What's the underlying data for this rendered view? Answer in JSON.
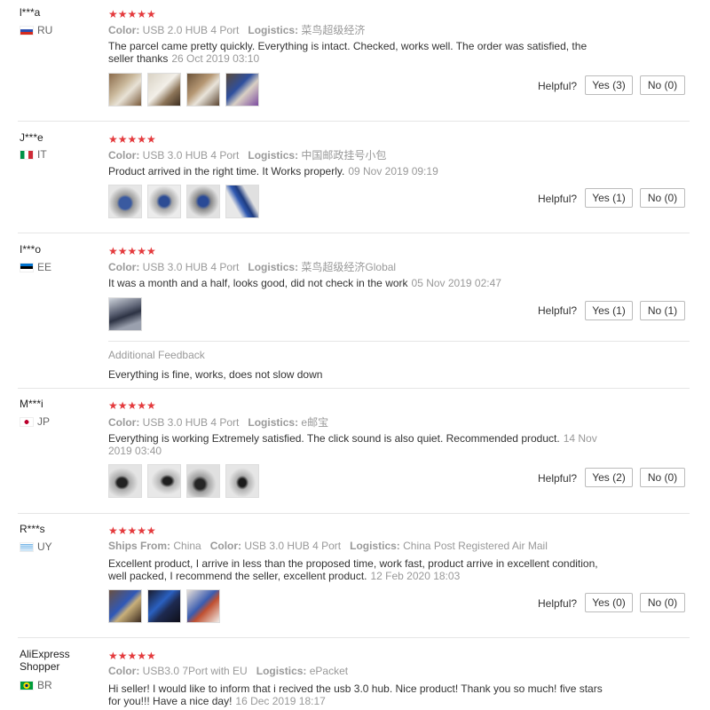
{
  "labels": {
    "color": "Color:",
    "logistics": "Logistics:",
    "ships_from": "Ships From:",
    "helpful": "Helpful?",
    "additional_feedback": "Additional Feedback",
    "stars": "★★★★★"
  },
  "reviews": [
    {
      "user": "l***a",
      "country": "RU",
      "color": "USB 2.0 HUB 4 Port",
      "logistics": "菜鸟超级经济",
      "text": "The parcel came pretty quickly. Everything is intact. Checked, works well. The order was satisfied, the seller thanks",
      "date": "26 Oct 2019 03:10",
      "yes": "Yes (3)",
      "no": "No (0)",
      "thumb_count": 4
    },
    {
      "user": "J***e",
      "country": "IT",
      "color": "USB 3.0 HUB 4 Port",
      "logistics": "中国邮政挂号小包",
      "text": "Product arrived in the right time. It Works properly.",
      "date": "09 Nov 2019 09:19",
      "yes": "Yes (1)",
      "no": "No (0)",
      "thumb_count": 4
    },
    {
      "user": "I***o",
      "country": "EE",
      "color": "USB 3.0 HUB 4 Port",
      "logistics": "菜鸟超级经济Global",
      "text": "It was a month and a half, looks good, did not check in the work",
      "date": "05 Nov 2019 02:47",
      "yes": "Yes (1)",
      "no": "No (1)",
      "thumb_count": 1,
      "additional_feedback": "Everything is fine, works, does not slow down"
    },
    {
      "user": "M***i",
      "country": "JP",
      "color": "USB 3.0 HUB 4 Port",
      "logistics": "e邮宝",
      "text": "Everything is working Extremely satisfied. The click sound is also quiet. Recommended product.",
      "date": "14 Nov 2019 03:40",
      "yes": "Yes (2)",
      "no": "No (0)",
      "thumb_count": 4
    },
    {
      "user": "R***s",
      "country": "UY",
      "ships_from": "China",
      "color": "USB 3.0 HUB 4 Port",
      "logistics": "China Post Registered Air Mail",
      "text": "Excellent product, I arrive in less than the proposed time, work fast, product arrive in excellent condition, well packed, I recommend the seller, excellent product.",
      "date": "12 Feb 2020 18:03",
      "yes": "Yes (0)",
      "no": "No (0)",
      "thumb_count": 3
    },
    {
      "user": "AliExpress Shopper",
      "country": "BR",
      "color": "USB3.0 7Port with EU",
      "logistics": "ePacket",
      "text": "Hi seller! I would like to inform that i recived the usb 3.0 hub. Nice product! Thank you so much! five stars for you!!! Have a nice day!",
      "date": "16 Dec 2019 18:17"
    }
  ]
}
